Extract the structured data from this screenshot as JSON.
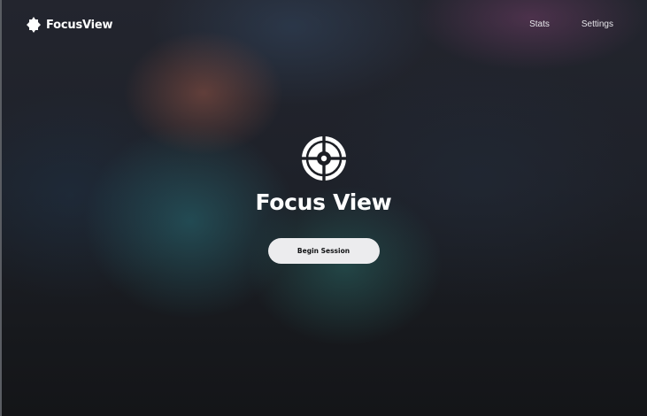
{
  "header": {
    "brand_name": "FocusView",
    "nav": [
      {
        "label": "Stats"
      },
      {
        "label": "Settings"
      }
    ]
  },
  "hero": {
    "title": "Focus View",
    "button_label": "Begin Session"
  },
  "icons": {
    "brand": "target-crosshair-icon",
    "hero": "target-crosshair-icon"
  },
  "colors": {
    "text": "#ffffff",
    "button_bg": "#ececee",
    "button_text": "#111214"
  }
}
